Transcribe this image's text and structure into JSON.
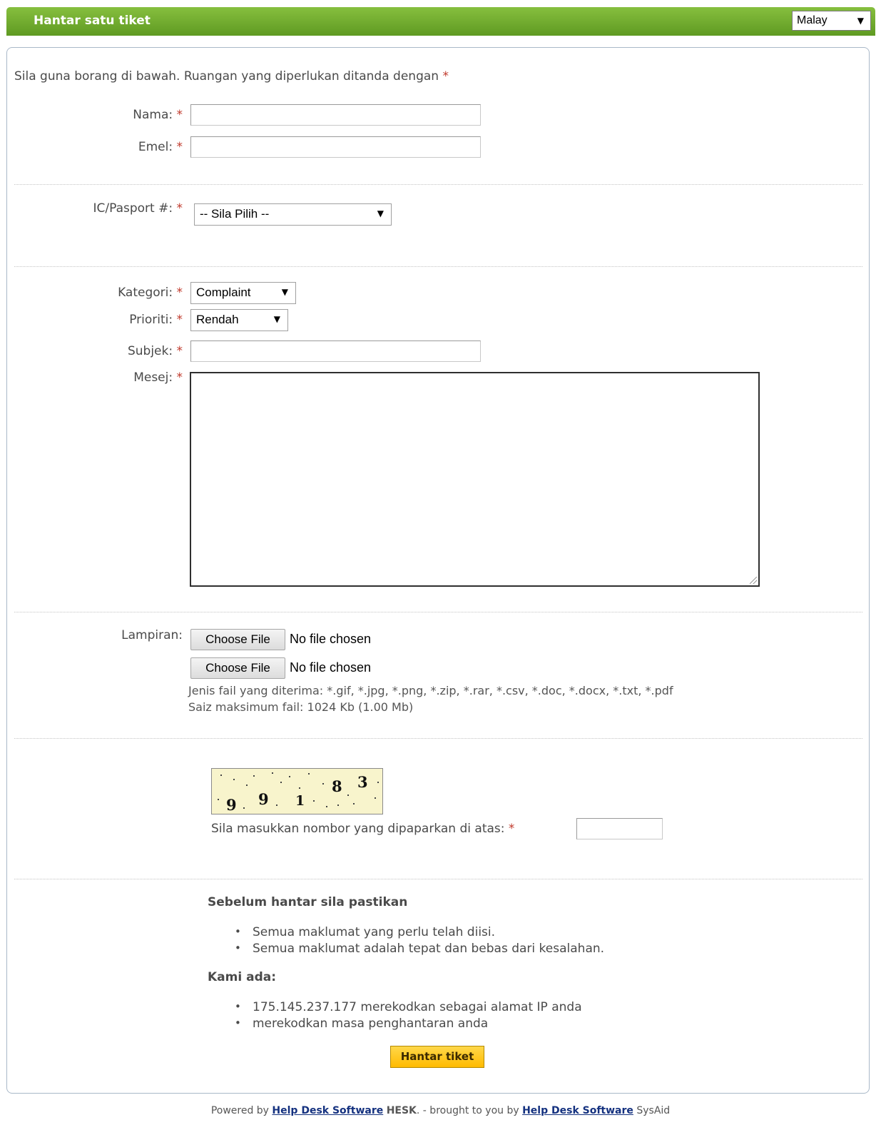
{
  "header": {
    "title": "Hantar satu tiket",
    "language": "Malay"
  },
  "form": {
    "intro": "Sila guna borang di bawah. Ruangan yang diperlukan ditanda dengan",
    "required_mark": "*",
    "name_label": "Nama:",
    "email_label": "Emel:",
    "ic_label": "IC/Pasport #:",
    "ic_selected": "-- Sila Pilih --",
    "category_label": "Kategori:",
    "category_selected": "Complaint",
    "priority_label": "Prioriti:",
    "priority_selected": "Rendah",
    "subject_label": "Subjek:",
    "message_label": "Mesej:",
    "attachments_label": "Lampiran:",
    "choose_file": "Choose File",
    "no_file": "No file chosen",
    "accepted_types": "Jenis fail yang diterima: *.gif, *.jpg, *.png, *.zip, *.rar, *.csv, *.doc, *.docx, *.txt, *.pdf",
    "max_size": "Saiz maksimum fail: 1024 Kb (1.00 Mb)",
    "captcha_digits": [
      "9",
      "9",
      "1",
      "8",
      "3"
    ],
    "captcha_label": "Sila masukkan nombor yang dipaparkan di atas:"
  },
  "checklist": {
    "before_title": "Sebelum hantar sila pastikan",
    "before_items": [
      "Semua maklumat yang perlu telah diisi.",
      "Semua maklumat adalah tepat dan bebas dari kesalahan."
    ],
    "we_title": "Kami ada:",
    "we_items": [
      "175.145.237.177 merekodkan sebagai alamat IP anda",
      "merekodkan masa penghantaran anda"
    ]
  },
  "submit_label": "Hantar tiket",
  "footer": {
    "powered_by": "Powered by",
    "link1": "Help Desk Software",
    "product": "HESK",
    "middle": ". - brought to you by",
    "link2": "Help Desk Software",
    "vendor": "SysAid"
  },
  "colors": {
    "header_green": "#6ea92d",
    "required_red": "#c0392b",
    "submit_yellow": "#ffc91a",
    "link_blue": "#14317f"
  }
}
